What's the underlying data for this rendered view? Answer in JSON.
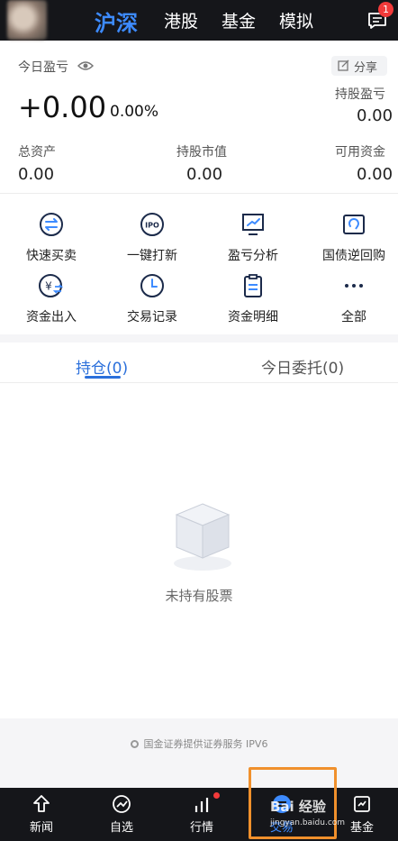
{
  "nav": {
    "tabs": [
      "沪深",
      "港股",
      "基金",
      "模拟"
    ],
    "active_tab": "沪深",
    "message_badge": "1"
  },
  "account": {
    "today_pl_label": "今日盈亏",
    "share_label": "分享",
    "today_pl_value": "+0.00",
    "today_pl_rate": "0.00%",
    "holding_pl_label": "持股盈亏",
    "holding_pl_value": "0.00",
    "total_assets_label": "总资产",
    "total_assets_value": "0.00",
    "market_value_label": "持股市值",
    "market_value_value": "0.00",
    "available_funds_label": "可用资金",
    "available_funds_value": "0.00"
  },
  "functions": [
    {
      "label": "快速买卖",
      "icon": "swap-icon"
    },
    {
      "label": "一键打新",
      "icon": "ipo-icon"
    },
    {
      "label": "盈亏分析",
      "icon": "chart-monitor-icon"
    },
    {
      "label": "国债逆回购",
      "icon": "repo-icon"
    },
    {
      "label": "资金出入",
      "icon": "yuan-transfer-icon"
    },
    {
      "label": "交易记录",
      "icon": "clock-icon"
    },
    {
      "label": "资金明细",
      "icon": "clipboard-icon"
    },
    {
      "label": "全部",
      "icon": "more-icon"
    }
  ],
  "holdings": {
    "tabs": [
      "持仓(0)",
      "今日委托(0)"
    ],
    "active_tab": "持仓(0)",
    "empty_text": "未持有股票"
  },
  "footer": {
    "note": "国金证券提供证券服务  IPV6"
  },
  "bottom_nav": [
    {
      "label": "新闻",
      "icon": "news-icon"
    },
    {
      "label": "自选",
      "icon": "watchlist-icon"
    },
    {
      "label": "行情",
      "icon": "market-icon"
    },
    {
      "label": "交易",
      "icon": "trade-icon"
    },
    {
      "label": "基金",
      "icon": "fund-icon"
    }
  ],
  "bottom_active": "交易",
  "watermark": {
    "text": "Bai 经验",
    "sub": "jingyan.baidu.com"
  },
  "colors": {
    "accent": "#3d8bff",
    "dark_bar": "#15161a",
    "badge": "#f23a3a",
    "highlight": "#f0902c"
  }
}
